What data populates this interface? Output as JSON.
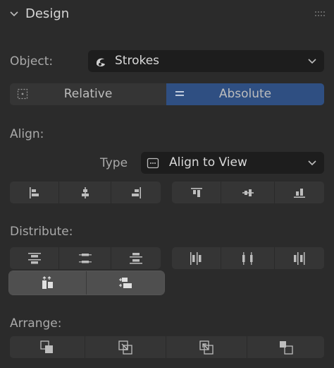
{
  "panel": {
    "title": "Design"
  },
  "object": {
    "label": "Object:",
    "value": "Strokes",
    "icon": "strokes-icon"
  },
  "space_toggle": {
    "relative_label": "Relative",
    "absolute_label": "Absolute",
    "selected": "Absolute",
    "accent_color": "#2f4f82"
  },
  "align": {
    "label": "Align:",
    "type_label": "Type",
    "type_value": "Align to View",
    "horizontal_icons": [
      "align-left-icon",
      "align-center-horizontal-icon",
      "align-right-icon"
    ],
    "vertical_icons": [
      "align-top-icon",
      "align-center-vertical-icon",
      "align-bottom-icon"
    ]
  },
  "distribute": {
    "label": "Distribute:",
    "vertical_icons": [
      "distribute-top-icon",
      "distribute-center-vertical-icon",
      "distribute-bottom-icon"
    ],
    "horizontal_icons": [
      "distribute-left-icon",
      "distribute-center-horizontal-icon",
      "distribute-right-icon"
    ],
    "spacing_icons": [
      "distribute-vertical-spacing-icon",
      "distribute-horizontal-spacing-icon"
    ]
  },
  "arrange": {
    "label": "Arrange:",
    "icons": [
      "bring-to-front-icon",
      "bring-forward-icon",
      "send-backward-icon",
      "send-to-back-icon"
    ]
  }
}
